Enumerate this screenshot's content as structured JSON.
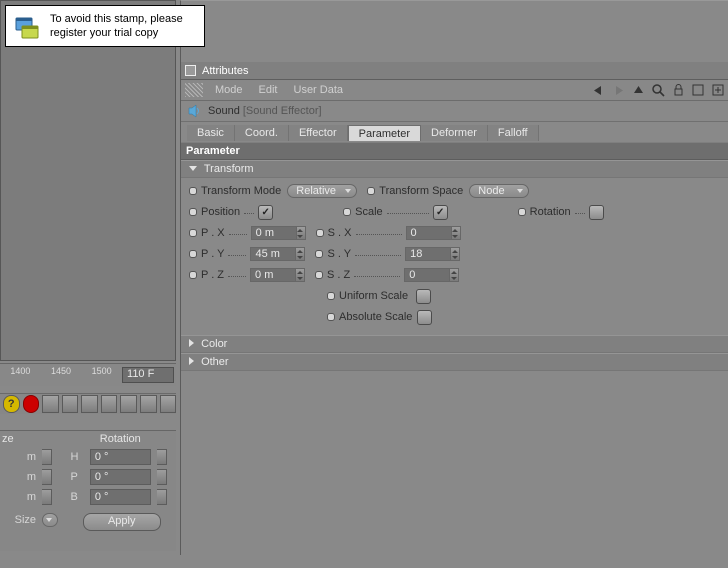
{
  "stamp": {
    "line1": "To avoid this stamp, please",
    "line2": "register your trial copy"
  },
  "attr": {
    "title": "Attributes",
    "menus": [
      "Mode",
      "Edit",
      "User Data"
    ],
    "sound_name": "Sound",
    "sound_kind": "[Sound Effector]",
    "tabs": [
      {
        "label": "Basic"
      },
      {
        "label": "Coord."
      },
      {
        "label": "Effector"
      },
      {
        "label": "Parameter",
        "active": true
      },
      {
        "label": "Deformer"
      },
      {
        "label": "Falloff"
      }
    ],
    "section_title": "Parameter",
    "group_transform": "Transform",
    "group_color": "Color",
    "group_other": "Other",
    "row_transform_mode_label": "Transform Mode",
    "row_transform_mode_value": "Relative",
    "row_transform_space_label": "Transform Space",
    "row_transform_space_value": "Node",
    "pos_label": "Position",
    "scale_label": "Scale",
    "rot_label": "Rotation",
    "px_label": "P . X",
    "py_label": "P . Y",
    "pz_label": "P . Z",
    "px_value": "0 m",
    "py_value": "45 m",
    "pz_value": "0 m",
    "sx_label": "S . X",
    "sy_label": "S . Y",
    "sz_label": "S . Z",
    "sx_value": "0",
    "sy_value": "18",
    "sz_value": "0",
    "uniform_label": "Uniform Scale",
    "absolute_label": "Absolute Scale",
    "pos_checked": true,
    "scale_checked": true,
    "rot_checked": false,
    "uniform_checked": false,
    "absolute_checked": false
  },
  "timeline": {
    "t1": "1400",
    "t2": "1450",
    "t3": "1500",
    "current": "110 F"
  },
  "mini": {
    "size_hdr": "ze",
    "rot_hdr": "Rotation",
    "unit": "m",
    "h_label": "H",
    "p_label": "P",
    "b_label": "B",
    "h_val": "0 °",
    "p_val": "0 °",
    "b_val": "0 °",
    "size_label": "Size",
    "apply": "Apply"
  }
}
